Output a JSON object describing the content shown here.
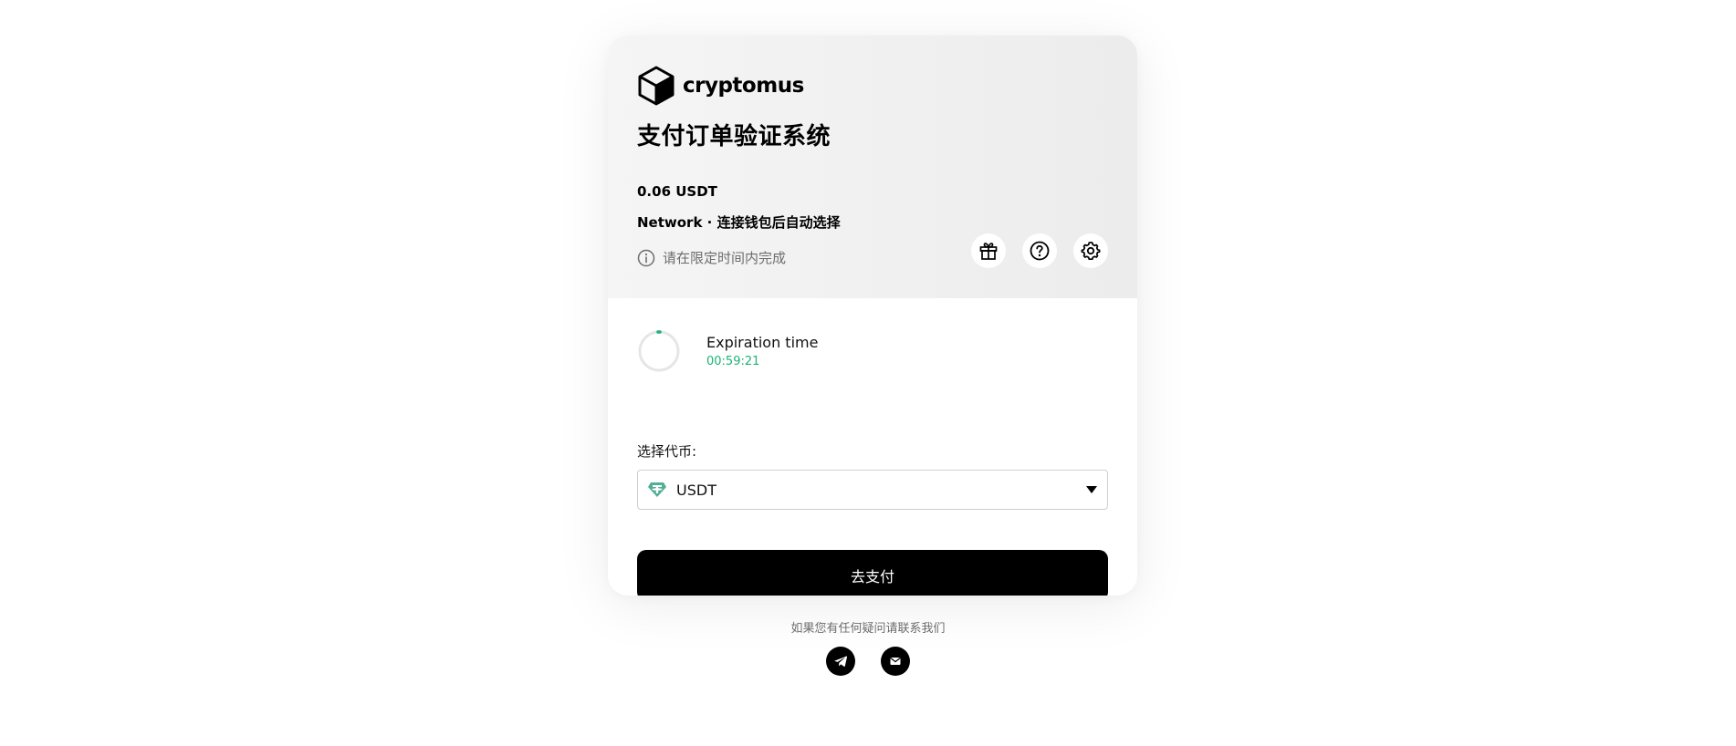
{
  "brand": {
    "name": "cryptomus"
  },
  "header": {
    "title": "支付订单验证系统",
    "amount": "0.06 USDT",
    "network": "Network · 连接钱包后自动选择",
    "notice": "请在限定时间内完成"
  },
  "timer": {
    "label": "Expiration time",
    "value": "00:59:21",
    "accent_color": "#1cb276"
  },
  "currency_select": {
    "label": "选择代币:",
    "selected": "USDT",
    "icon": "tether-icon"
  },
  "pay_button": {
    "label": "去支付"
  },
  "footer": {
    "text": "如果您有任何疑问请联系我们"
  },
  "icons": [
    "gift-icon",
    "help-icon",
    "gear-icon",
    "telegram-icon",
    "mail-icon",
    "info-icon"
  ]
}
